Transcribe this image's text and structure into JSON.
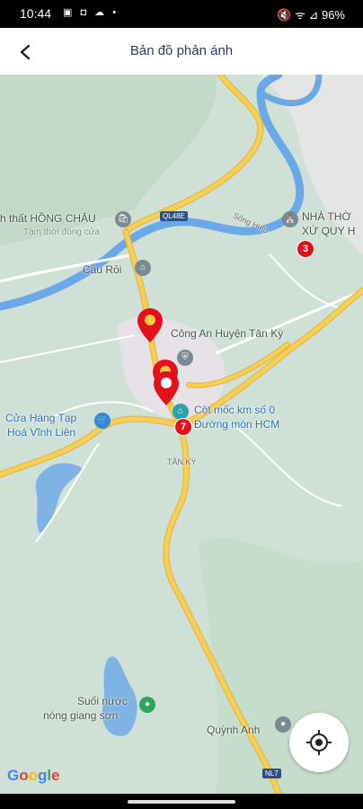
{
  "status_bar": {
    "time": "10:44",
    "left_icons": "▣ ◘ ☁ •",
    "right": "🔇 ᯤ ⊿ 96%"
  },
  "app_bar": {
    "title": "Bản đồ phản ánh",
    "back_icon": "arrow-left-icon"
  },
  "map": {
    "labels": {
      "hong_chau": "h thất HỒNG CHÂU",
      "hong_chau_status": "Tạm thời đóng cửa",
      "nha_tho_1": "NHÀ THỜ",
      "nha_tho_2": "XỨ QUY H",
      "cau_roi": "Cầu Rỏi",
      "cong_an": "Công An Huyện Tân Kỳ",
      "cot_moc_1": "Cột mốc km số 0",
      "cot_moc_2": "Đường mòn HCM",
      "cua_hang_1": "Cửa Hàng Tạp",
      "cua_hang_2": "Hoá Vĩnh Liên",
      "tan_ky": "TÂN KỲ",
      "suoi_1": "Suối nước",
      "suoi_2": "nóng giang sơn",
      "quynh_anh": "Quỳnh Anh",
      "river": "Sông Hiếu"
    },
    "shields": {
      "ql48e": "QL48E",
      "nl7": "NL7"
    },
    "markers": [
      {
        "name": "marker-3",
        "count": "3"
      },
      {
        "name": "marker-7",
        "count": "7"
      }
    ],
    "attribution": {
      "letters": [
        "G",
        "o",
        "o",
        "g",
        "l",
        "e"
      ],
      "colors": [
        "#4285F4",
        "#EA4335",
        "#FBBC05",
        "#4285F4",
        "#34A853",
        "#EA4335"
      ]
    },
    "locate_icon": "crosshair-icon"
  },
  "colors": {
    "road": "#f6cf57",
    "river": "#6aa8e8",
    "pin": "#e3111b",
    "title": "#2c3b63"
  }
}
